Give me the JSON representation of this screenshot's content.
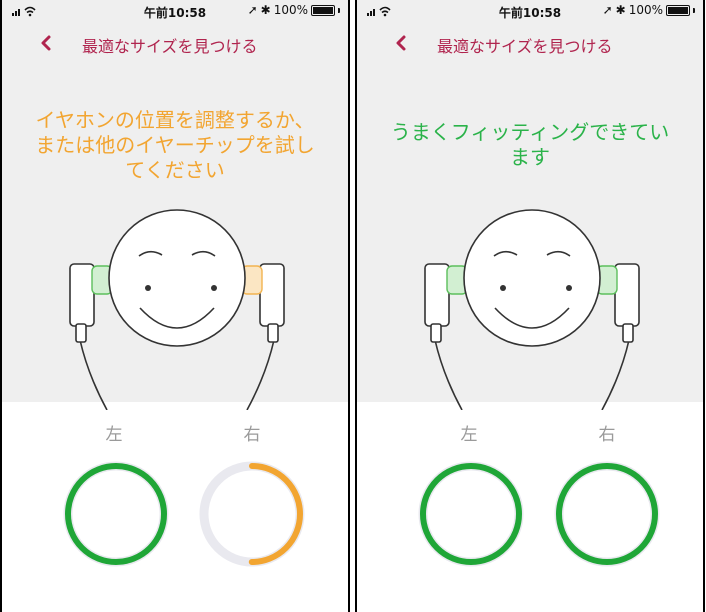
{
  "status_bar": {
    "time": "午前10:58",
    "battery": "100%"
  },
  "screens": [
    {
      "nav_title": "最適なサイズを見つける",
      "message": "イヤホンの位置を調整するか、または他のイヤーチップを試してください",
      "message_lines": [
        "イヤホンの位置を調整するか、",
        "または他のイヤーチップを試し",
        "てください"
      ],
      "left_label": "左",
      "right_label": "右",
      "left_fit": {
        "status": "good",
        "progress": 1.0
      },
      "right_fit": {
        "status": "adjust",
        "progress": 0.5
      }
    },
    {
      "nav_title": "最適なサイズを見つける",
      "message": "うまくフィッティングできています",
      "message_lines": [
        "うまくフィッティングできてい",
        "ます"
      ],
      "left_label": "左",
      "right_label": "右",
      "left_fit": {
        "status": "good",
        "progress": 1.0
      },
      "right_fit": {
        "status": "good",
        "progress": 1.0
      }
    }
  ],
  "colors": {
    "accent": "#b0244e",
    "good": "#1fa637",
    "warn": "#f2a531",
    "track": "#e9e9ef",
    "background_top": "#efefef"
  },
  "icons": [
    "signal-icon",
    "wifi-icon",
    "location-icon",
    "bluetooth-icon",
    "battery-icon",
    "back-chevron-icon"
  ]
}
